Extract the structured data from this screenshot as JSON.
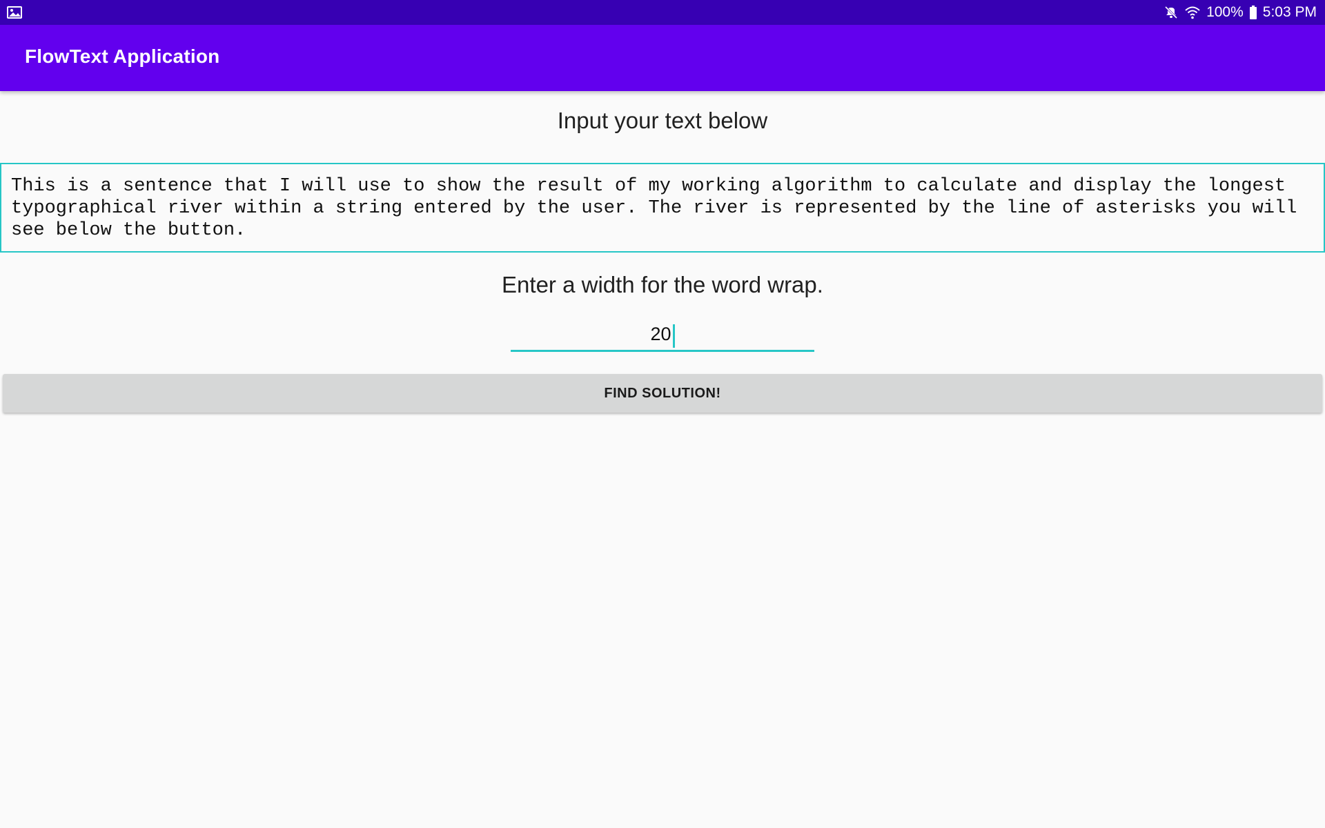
{
  "status_bar": {
    "icons": [
      "image-icon",
      "mute-icon",
      "wifi-icon",
      "battery-icon"
    ],
    "battery": "100%",
    "time": "5:03 PM"
  },
  "app_bar": {
    "title": "FlowText Application",
    "color": "#6200ee"
  },
  "main": {
    "prompt_heading": "Input your text below",
    "input_text": "This is a sentence that I will use to show the result of my working algorithm to calculate and display the longest typographical river within a string entered by the user. The river is represented by the line of asterisks you will see below the button.",
    "width_heading": "Enter a width for the word wrap.",
    "width_value": "20",
    "find_button_label": "FIND SOLUTION!"
  },
  "colors": {
    "status_bar": "#3700b3",
    "accent": "#26c6c6",
    "button": "#d6d7d7",
    "background": "#fafafa"
  }
}
